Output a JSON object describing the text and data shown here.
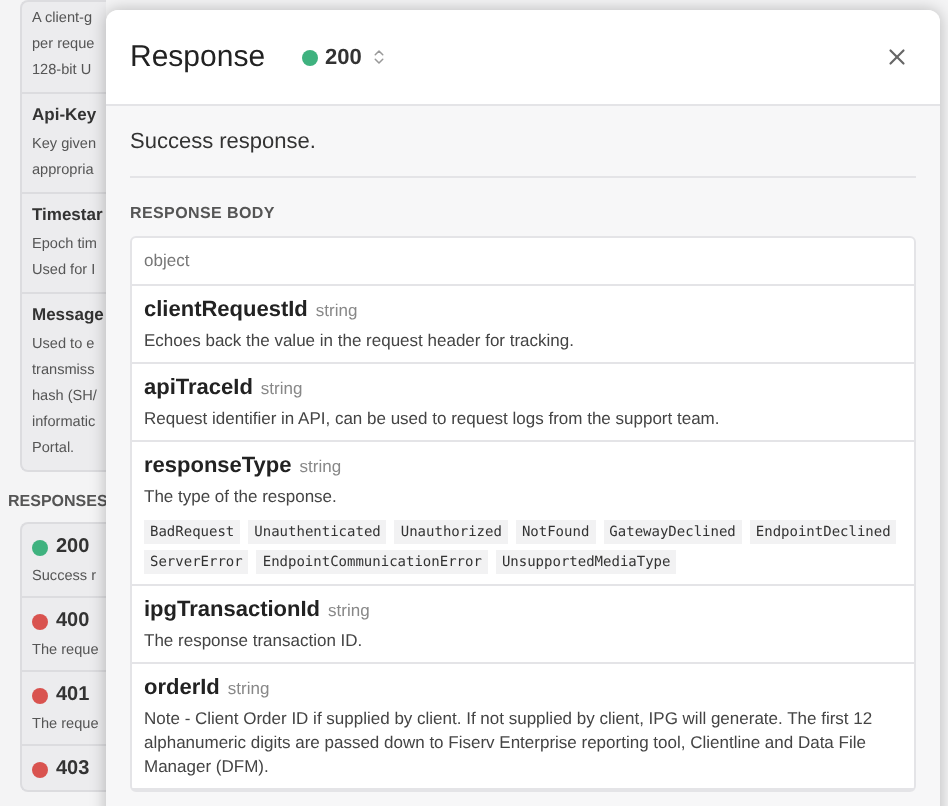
{
  "background": {
    "params": [
      {
        "lines": [
          "A client-g",
          "per reque",
          "128-bit U"
        ]
      },
      {
        "name": "Api-Key",
        "lines": [
          "Key given",
          "appropria"
        ]
      },
      {
        "name": "Timestar",
        "lines": [
          "Epoch tim",
          "Used for I"
        ]
      },
      {
        "name": "Message",
        "lines": [
          "Used to e",
          "transmiss",
          "hash (SH/",
          "informatic",
          "Portal."
        ]
      }
    ],
    "responses_heading": "RESPONSES",
    "responses": [
      {
        "code": "200",
        "color": "#3fb27f",
        "text": "Success r"
      },
      {
        "code": "400",
        "color": "#d9534f",
        "text": "The reque"
      },
      {
        "code": "401",
        "color": "#d9534f",
        "text": "The reque"
      },
      {
        "code": "403",
        "color": "#d9534f"
      }
    ]
  },
  "modal": {
    "title": "Response",
    "status": {
      "code": "200",
      "color": "#3fb27f"
    },
    "description": "Success response.",
    "body_heading": "RESPONSE BODY",
    "type": "object",
    "fields": [
      {
        "name": "clientRequestId",
        "type": "string",
        "description": "Echoes back the value in the request header for tracking."
      },
      {
        "name": "apiTraceId",
        "type": "string",
        "description": "Request identifier in API, can be used to request logs from the support team."
      },
      {
        "name": "responseType",
        "type": "string",
        "description": "The type of the response.",
        "enum": [
          "BadRequest",
          "Unauthenticated",
          "Unauthorized",
          "NotFound",
          "GatewayDeclined",
          "EndpointDeclined",
          "ServerError",
          "EndpointCommunicationError",
          "UnsupportedMediaType"
        ]
      },
      {
        "name": "ipgTransactionId",
        "type": "string",
        "description": "The response transaction ID."
      },
      {
        "name": "orderId",
        "type": "string",
        "description": "Note - Client Order ID if supplied by client. If not supplied by client, IPG will generate. The first 12 alphanumeric digits are passed down to Fiserv Enterprise reporting tool, Clientline and Data File Manager (DFM)."
      }
    ]
  }
}
